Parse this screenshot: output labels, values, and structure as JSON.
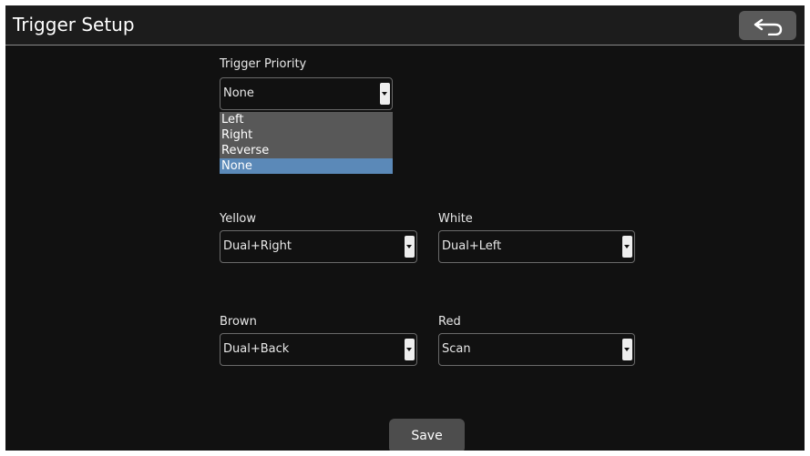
{
  "header": {
    "title": "Trigger Setup",
    "back_icon": "back-arrow-icon"
  },
  "trigger_priority": {
    "label": "Trigger Priority",
    "value": "None",
    "options": [
      {
        "label": "Left",
        "selected": false
      },
      {
        "label": "Right",
        "selected": false
      },
      {
        "label": "Reverse",
        "selected": false
      },
      {
        "label": "None",
        "selected": true
      }
    ]
  },
  "yellow": {
    "label": "Yellow",
    "value": "Dual+Right"
  },
  "white": {
    "label": "White",
    "value": "Dual+Left"
  },
  "brown": {
    "label": "Brown",
    "value": "Dual+Back"
  },
  "red": {
    "label": "Red",
    "value": "Scan"
  },
  "save_label": "Save",
  "colors": {
    "background": "#111111",
    "selected_option": "#5b89b8",
    "dropdown_bg": "#585858",
    "button_bg": "#4d4d4d"
  }
}
